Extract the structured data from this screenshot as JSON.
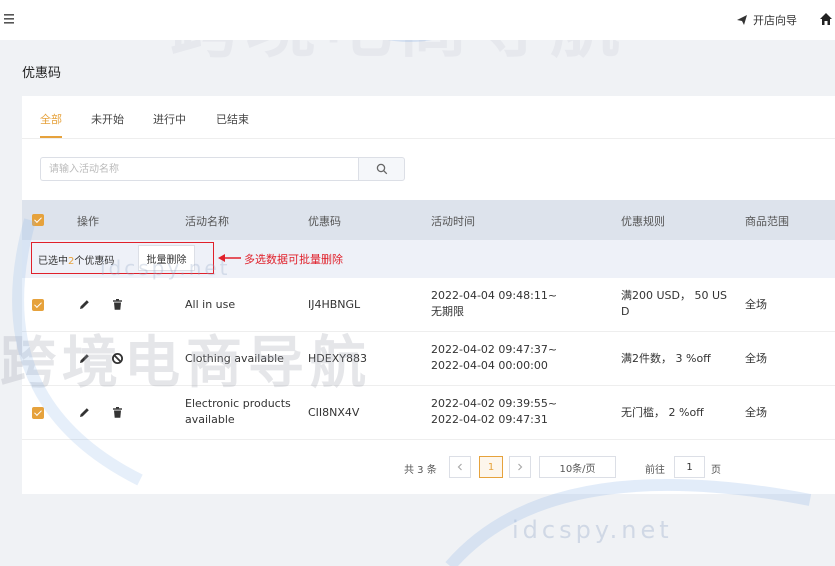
{
  "topbar": {
    "guide_label": "开店向导"
  },
  "page": {
    "title": "优惠码"
  },
  "tabs": [
    {
      "label": "全部",
      "active": true
    },
    {
      "label": "未开始",
      "active": false
    },
    {
      "label": "进行中",
      "active": false
    },
    {
      "label": "已结束",
      "active": false
    }
  ],
  "search": {
    "placeholder": "请输入活动名称",
    "value": ""
  },
  "table": {
    "headers": [
      "操作",
      "活动名称",
      "优惠码",
      "活动时间",
      "优惠规则",
      "商品范围"
    ],
    "rows": [
      {
        "name": "All in use",
        "code": "IJ4HBNGL",
        "time": [
          "2022-04-04 09:48:11~",
          "无期限"
        ],
        "rule": [
          "满200 USD， 50 US",
          "D"
        ],
        "scope": "全场",
        "status_icon": "delete-icon"
      },
      {
        "name": "Clothing available",
        "code": "HDEXY883",
        "time": [
          "2022-04-02 09:47:37~",
          "2022-04-04 00:00:00"
        ],
        "rule": [
          "满2件数， 3 %off"
        ],
        "scope": "全场",
        "status_icon": "disable-icon"
      },
      {
        "name_lines": [
          "Electronic products",
          "available"
        ],
        "code": "CII8NX4V",
        "time": [
          "2022-04-02 09:39:55~",
          "2022-04-02 09:47:31"
        ],
        "rule": [
          "无门槛， 2 %off"
        ],
        "scope": "全场",
        "status_icon": "delete-icon"
      }
    ]
  },
  "batch": {
    "selected_prefix": "已选中",
    "selected_count": "2",
    "selected_suffix": "个优惠码",
    "delete_label": "批量删除"
  },
  "annotation": "多选数据可批量删除",
  "pagination": {
    "total": "共 3 条",
    "current": "1",
    "page_size": "10条/页",
    "jump_prefix": "前往",
    "jump_value": "1",
    "jump_suffix": "页"
  },
  "watermark": {
    "text": "跨境电商导航",
    "site": "idcspy.net"
  },
  "colors": {
    "accent": "#e6a23c",
    "annotation": "#e0202a",
    "header_bg": "#dde3ec"
  }
}
